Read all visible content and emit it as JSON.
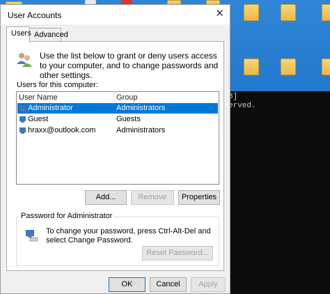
{
  "dialog": {
    "title": "User Accounts",
    "tabs": [
      {
        "label": "Users",
        "active": true
      },
      {
        "label": "Advanced",
        "active": false
      }
    ],
    "intro_text": "Use the list below to grant or deny users access to your computer, and to change passwords and other settings.",
    "users_label": "Users for this computer:",
    "columns": [
      "User Name",
      "Group"
    ],
    "rows": [
      {
        "name": "Administrator",
        "group": "Administrators",
        "selected": true
      },
      {
        "name": "Guest",
        "group": "Guests",
        "selected": false
      },
      {
        "name": "hraxx@outlook.com",
        "group": "Administrators",
        "selected": false
      }
    ],
    "buttons": {
      "add": "Add...",
      "remove": "Remove",
      "properties": "Properties",
      "reset_password": "Reset Password...",
      "ok": "OK",
      "cancel": "Cancel",
      "apply": "Apply"
    },
    "password_group_title": "Password for Administrator",
    "password_text": "To change your password, press Ctrl-Alt-Del and select Change Password.",
    "close_glyph": "✕"
  },
  "console": {
    "lines": [
      "8]",
      "erved."
    ]
  },
  "colors": {
    "selection": "#0078d7",
    "desktop": "#1e76cc",
    "console_bg": "#0c0c0c"
  },
  "icons": [
    "users-icon",
    "user-row-icon",
    "admin-keyboard-icon",
    "close-icon",
    "folder-icon"
  ]
}
